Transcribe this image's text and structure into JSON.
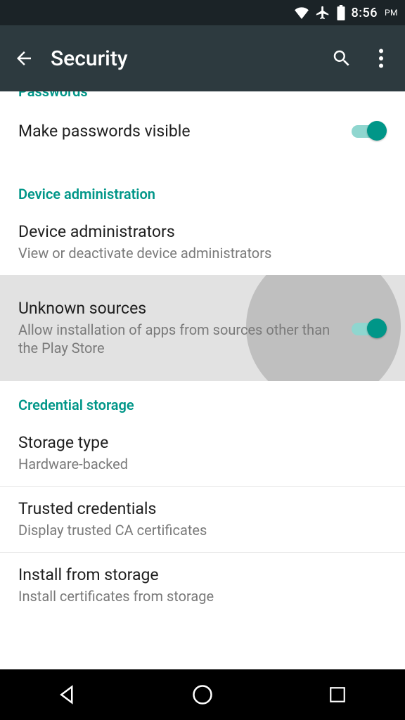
{
  "statusbar": {
    "time": "8:56",
    "ampm": "PM"
  },
  "appbar": {
    "title": "Security"
  },
  "sections": {
    "passwords": {
      "header": "Passwords",
      "make_visible": {
        "label": "Make passwords visible",
        "on": true
      }
    },
    "device_admin": {
      "header": "Device administration",
      "admins": {
        "label": "Device administrators",
        "sub": "View or deactivate device administrators"
      },
      "unknown": {
        "label": "Unknown sources",
        "sub": "Allow installation of apps from sources other than the Play Store",
        "on": true
      }
    },
    "cred_storage": {
      "header": "Credential storage",
      "storage_type": {
        "label": "Storage type",
        "sub": "Hardware-backed"
      },
      "trusted": {
        "label": "Trusted credentials",
        "sub": "Display trusted CA certificates"
      },
      "install": {
        "label": "Install from storage",
        "sub": "Install certificates from storage"
      }
    }
  }
}
